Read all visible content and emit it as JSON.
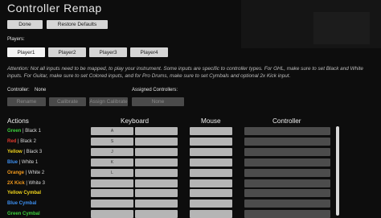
{
  "title": "Controller Remap",
  "top_buttons": {
    "done": "Done",
    "restore": "Restore Defaults"
  },
  "players_label": "Players:",
  "players": [
    "Player1",
    "Player2",
    "Player3",
    "Player4"
  ],
  "attention": "Attention: Not all inputs need to be mapped, to play your instrument. Some inputs are specific to controller types. For GHL, make sure to set Black and White inputs. For Guitar, make sure to set Colored inputs, and for Pro Drums, make sure to set Cymbals and optional 2x Kick input.",
  "controller_label": "Controller:",
  "controller_value": "None",
  "assigned_label": "Assigned Controllers:",
  "controller_buttons": [
    "Rename",
    "Calibrate",
    "Assign Calibrate"
  ],
  "assigned_value": "None",
  "columns": {
    "actions": "Actions",
    "keyboard": "Keyboard",
    "mouse": "Mouse",
    "controller": "Controller"
  },
  "actions": [
    {
      "color_name": "Green",
      "suffix": " | Black 1",
      "color": "#3ccf3c",
      "key": "A"
    },
    {
      "color_name": "Red",
      "suffix": " | Black 2",
      "color": "#e23a2e",
      "key": "S"
    },
    {
      "color_name": "Yellow",
      "suffix": " | Black 3",
      "color": "#f2d51c",
      "key": "J"
    },
    {
      "color_name": "Blue",
      "suffix": " | White 1",
      "color": "#3d8ff0",
      "key": "K"
    },
    {
      "color_name": "Orange",
      "suffix": " | White 2",
      "color": "#f39a1d",
      "key": "L"
    },
    {
      "color_name": "2X Kick",
      "suffix": " | White 3",
      "color": "#f39a1d",
      "key": ""
    },
    {
      "color_name": "Yellow Cymbal",
      "suffix": "",
      "color": "#f2d51c",
      "key": ""
    },
    {
      "color_name": "Blue Cymbal",
      "suffix": "",
      "color": "#3d8ff0",
      "key": ""
    },
    {
      "color_name": "Green Cymbal",
      "suffix": "",
      "color": "#3ccf3c",
      "key": ""
    }
  ]
}
